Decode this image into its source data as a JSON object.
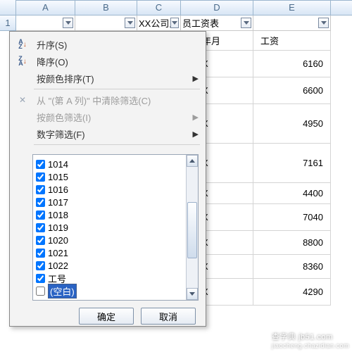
{
  "columns": {
    "A": "A",
    "B": "B",
    "C": "C",
    "D": "D",
    "E": "E"
  },
  "rowhead1": "1",
  "row1": {
    "c_text": "XX公司人",
    "d_text": "员工资表"
  },
  "headers": {
    "d": "出生年月",
    "e": "工资"
  },
  "data_rows": [
    {
      "d": "XXXX",
      "e": "6160"
    },
    {
      "d": "XXXX",
      "e": "6600"
    },
    {
      "d": "XXXX",
      "e": "4950"
    },
    {
      "d": "XXXX",
      "e": "7161"
    },
    {
      "d": "XXXX",
      "e": "4400"
    },
    {
      "d": "XXXX",
      "e": "7040"
    },
    {
      "d": "XXXX",
      "e": "8800"
    },
    {
      "d": "XXXX",
      "e": "8360"
    },
    {
      "d": "XXXX",
      "e": "4290"
    }
  ],
  "menu": {
    "asc": "升序(S)",
    "desc": "降序(O)",
    "sort_color": "按颜色排序(T)",
    "clear_filter": "从 \"(第 A 列)\" 中清除筛选(C)",
    "filter_color": "按颜色筛选(I)",
    "number_filter": "数字筛选(F)",
    "arrow": "▶"
  },
  "checklist": [
    "1014",
    "1015",
    "1016",
    "1017",
    "1018",
    "1019",
    "1020",
    "1021",
    "1022",
    "工号",
    "(空白)"
  ],
  "checklist_blank_index": 10,
  "buttons": {
    "ok": "确定",
    "cancel": "取消"
  },
  "watermark": {
    "l1": "查字典 jb51.com",
    "l2": "jiaocheng.chazidian.com"
  }
}
